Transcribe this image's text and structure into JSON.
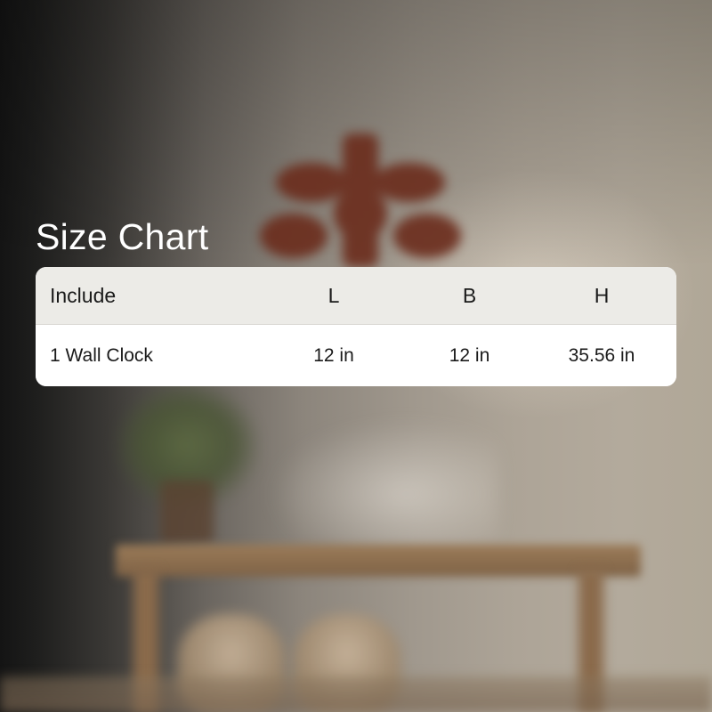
{
  "title": "Size Chart",
  "table": {
    "headers": [
      "Include",
      "L",
      "B",
      "H"
    ],
    "rows": [
      [
        "1 Wall Clock",
        "12 in",
        "12 in",
        "35.56 in"
      ]
    ]
  },
  "colors": {
    "title_text": "#ffffff",
    "header_bg": "#ecebe7",
    "body_bg": "#ffffff",
    "cell_text": "#1a1a1a"
  }
}
